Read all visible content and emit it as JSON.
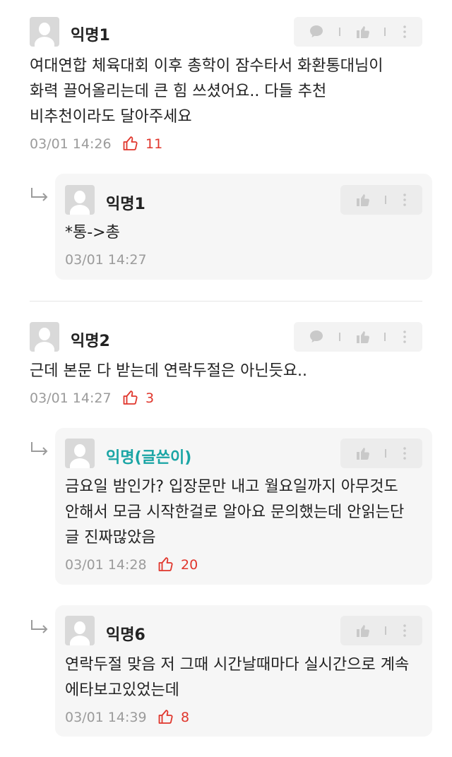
{
  "comments": [
    {
      "nickname": "익명1",
      "text": "여대연합 체육대회 이후 총학이 잠수타서 화환통대님이\n화력 끌어올리는데 큰 힘 쓰셨어요.. 다들 추천\n비추천이라도 달아주세요",
      "time": "03/01 14:26",
      "likes": "11"
    },
    {
      "nickname": "익명1",
      "text": "*통->총",
      "time": "03/01 14:27",
      "likes": ""
    },
    {
      "nickname": "익명2",
      "text": "근데 본문 다 받는데 연락두절은 아닌듯요..",
      "time": "03/01 14:27",
      "likes": "3"
    },
    {
      "nickname": "익명(글쓴이)",
      "text": "금요일 밤인가? 입장문만 내고 월요일까지 아무것도\n안해서 모금 시작한걸로 알아요 문의했는데 안읽는단\n글 진짜많았음",
      "time": "03/01 14:28",
      "likes": "20"
    },
    {
      "nickname": "익명6",
      "text": "연락두절 맞음 저 그때 시간날때마다 실시간으로 계속\n에타보고있었는데",
      "time": "03/01 14:39",
      "likes": "8"
    }
  ],
  "icons": {
    "reply": "speech-bubble-icon",
    "like": "thumbs-up-icon",
    "more": "vertical-dots-icon",
    "reply_arrow": "reply-arrow-icon"
  },
  "colors": {
    "writer": "#1aa5a5",
    "likes": "#e0362c",
    "meta": "#9b9b9b"
  }
}
